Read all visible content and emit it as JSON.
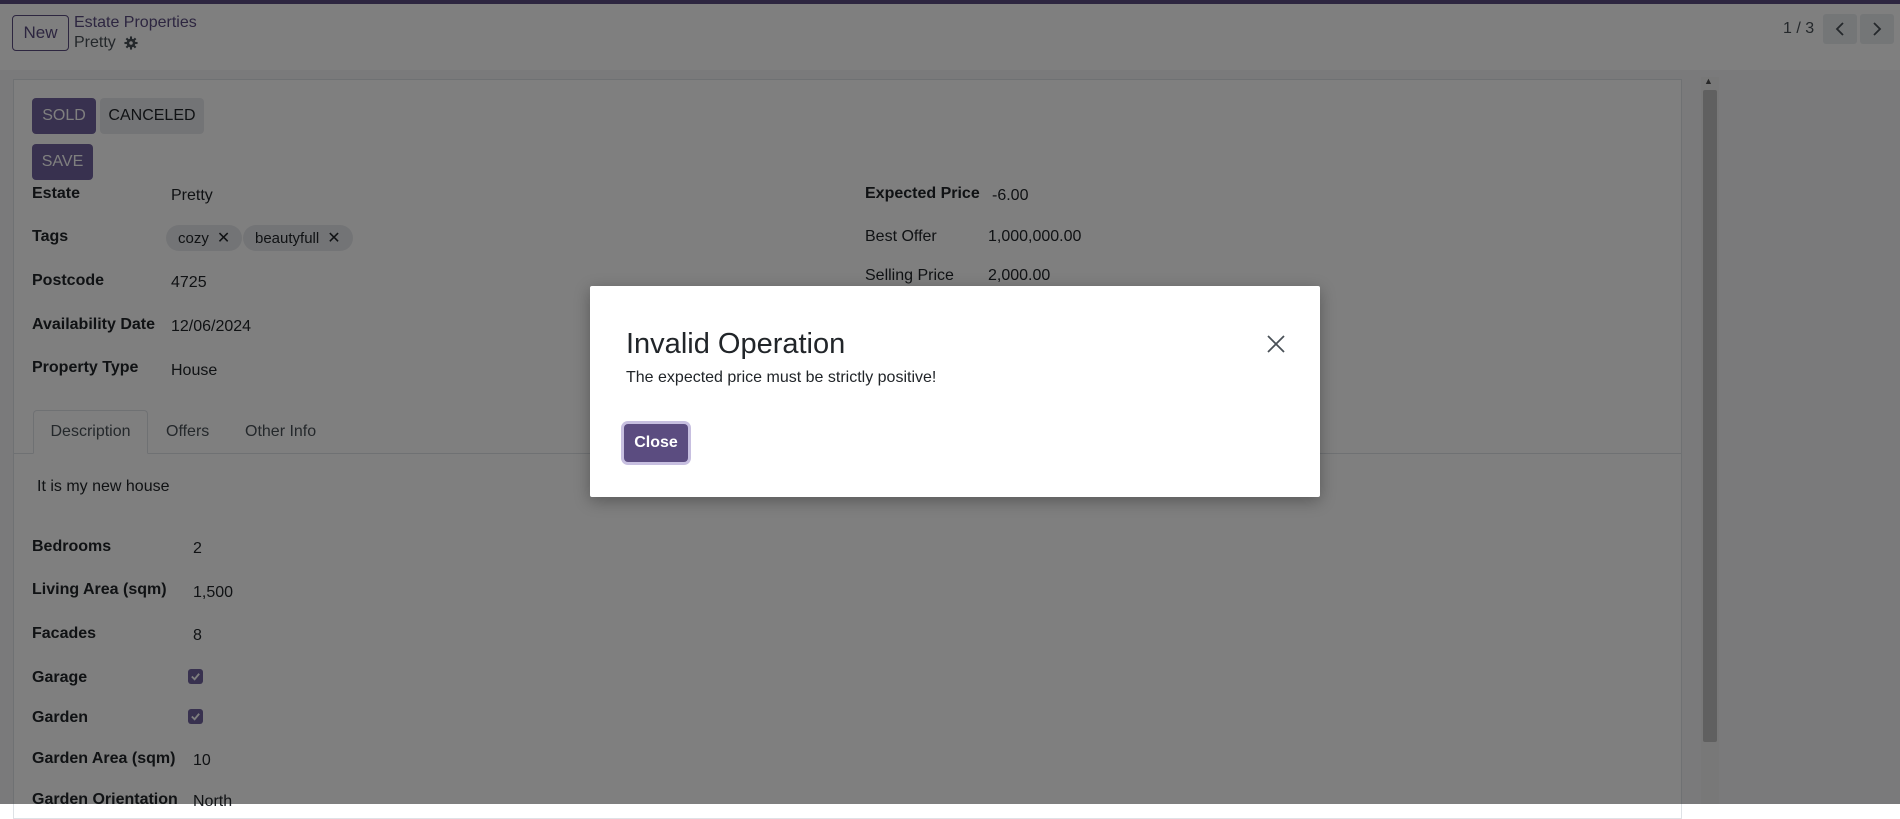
{
  "control_panel": {
    "new_button": "New",
    "breadcrumb_parent": "Estate Properties",
    "breadcrumb_current": "Pretty",
    "pager": "1 / 3"
  },
  "statusbar": {
    "sold": "SOLD",
    "canceled": "CANCELED",
    "save": "SAVE"
  },
  "form": {
    "left": [
      {
        "label": "Estate",
        "value": "Pretty"
      },
      {
        "label": "Tags",
        "tags": [
          "cozy",
          "beautyfull"
        ]
      },
      {
        "label": "Postcode",
        "value": "4725"
      },
      {
        "label": "Availability Date",
        "value": "12/06/2024"
      },
      {
        "label": "Property Type",
        "value": "House"
      }
    ],
    "right": [
      {
        "label": "Expected Price",
        "value": "-6.00"
      },
      {
        "label": "Best Offer",
        "value": "1,000,000.00"
      },
      {
        "label": "Selling Price",
        "value": "2,000.00"
      }
    ]
  },
  "tabs": [
    "Description",
    "Offers",
    "Other Info"
  ],
  "description": {
    "text": "It is my new house",
    "fields": [
      {
        "label": "Bedrooms",
        "value": "2"
      },
      {
        "label": "Living Area (sqm)",
        "value": "1,500"
      },
      {
        "label": "Facades",
        "value": "8"
      },
      {
        "label": "Garage",
        "checked": true
      },
      {
        "label": "Garden",
        "checked": true
      },
      {
        "label": "Garden Area (sqm)",
        "value": "10"
      },
      {
        "label": "Garden Orientation",
        "value": "North"
      }
    ]
  },
  "dialog": {
    "title": "Invalid Operation",
    "message": "The expected price must be strictly positive!",
    "close_button": "Close"
  },
  "colors": {
    "brand": "#71639e",
    "brand_dark": "#5b4c80",
    "overlay": "rgba(0,0,0,0.5)"
  }
}
